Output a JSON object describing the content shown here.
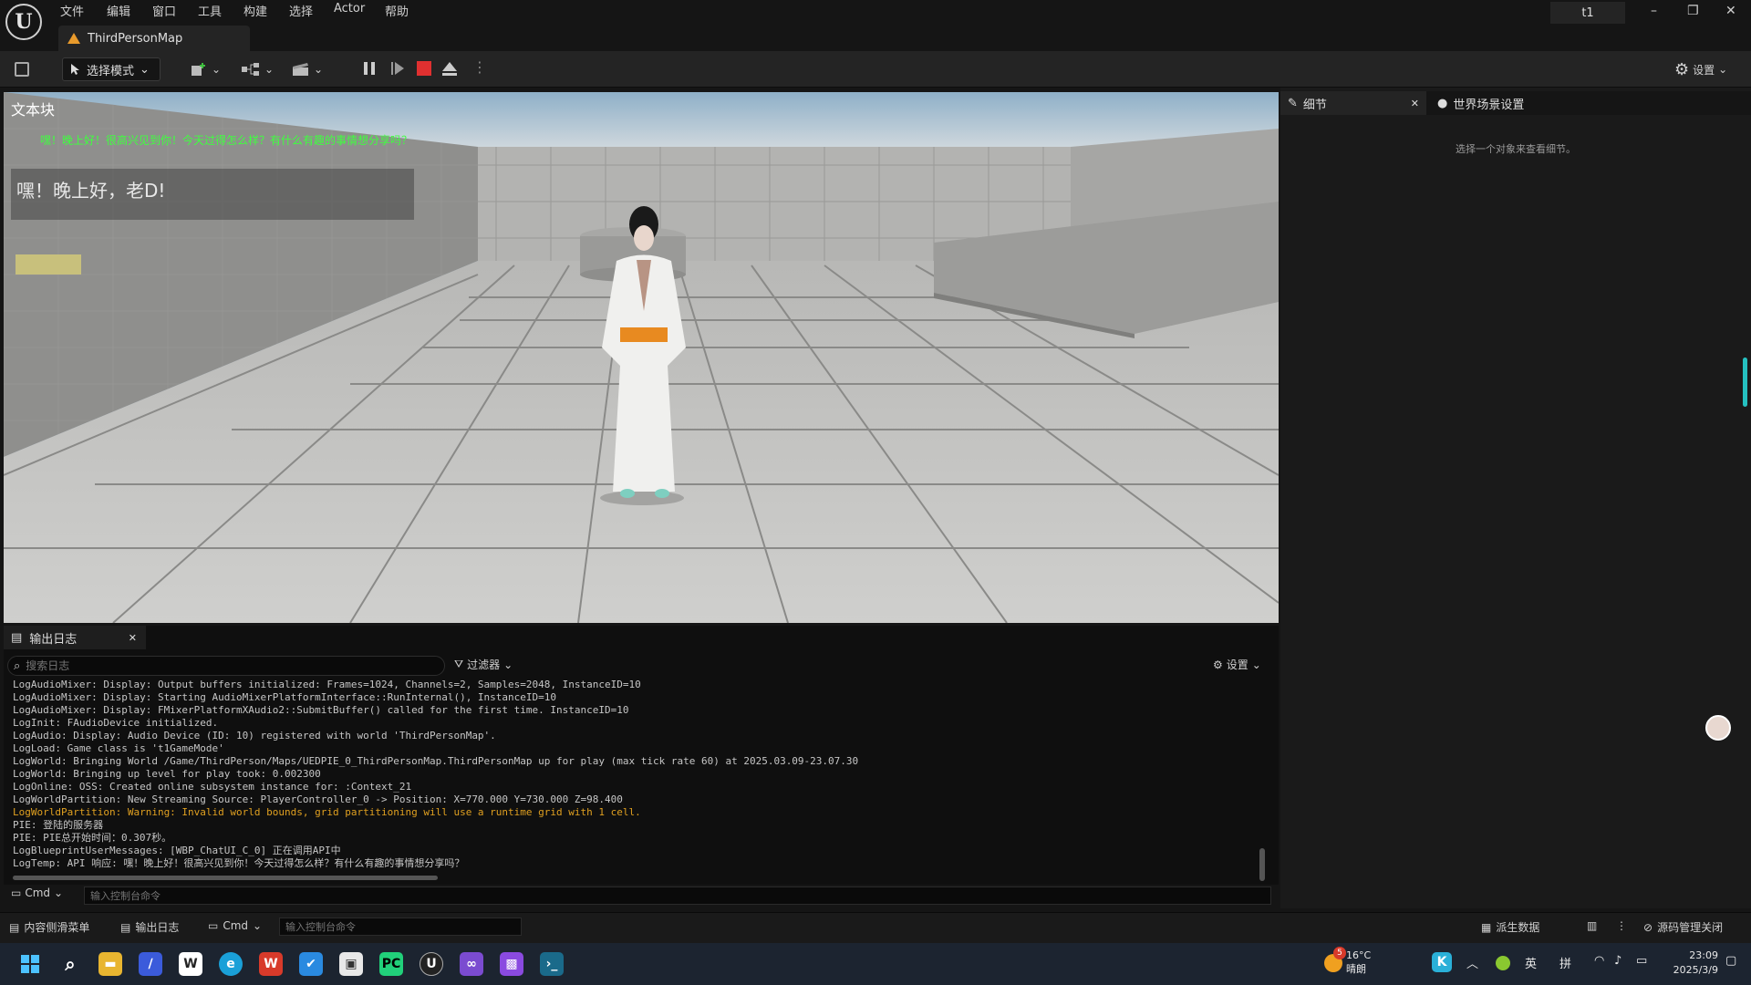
{
  "menu": [
    "文件",
    "编辑",
    "窗口",
    "工具",
    "构建",
    "选择",
    "Actor",
    "帮助"
  ],
  "window": {
    "user": "t1",
    "minimize": "–",
    "restore": "❐",
    "close": "✕"
  },
  "map_tab": "ThirdPersonMap",
  "toolbar": {
    "mode": "选择模式",
    "settings": "设置"
  },
  "viewport": {
    "title": "文本块",
    "green_text": "嘿！晚上好！很高兴见到你！今天过得怎么样？有什么有趣的事情想分享吗？",
    "chat_text": "嘿！晚上好，老D!"
  },
  "panels": {
    "details_tab": "细节",
    "world_tab": "世界场景设置",
    "hint": "选择一个对象来查看细节。"
  },
  "output_log": {
    "tab": "输出日志",
    "search_placeholder": "搜索日志",
    "filter": "过滤器",
    "settings": "设置",
    "lines": [
      {
        "text": "LogAudioMixer: Display: Output buffers initialized: Frames=1024, Channels=2, Samples=2048, InstanceID=10",
        "level": "info"
      },
      {
        "text": "LogAudioMixer: Display: Starting AudioMixerPlatformInterface::RunInternal(), InstanceID=10",
        "level": "info"
      },
      {
        "text": "LogAudioMixer: Display: FMixerPlatformXAudio2::SubmitBuffer() called for the first time. InstanceID=10",
        "level": "info"
      },
      {
        "text": "LogInit: FAudioDevice initialized.",
        "level": "info"
      },
      {
        "text": "LogAudio: Display: Audio Device (ID: 10) registered with world 'ThirdPersonMap'.",
        "level": "info"
      },
      {
        "text": "LogLoad: Game class is 't1GameMode'",
        "level": "info"
      },
      {
        "text": "LogWorld: Bringing World /Game/ThirdPerson/Maps/UEDPIE_0_ThirdPersonMap.ThirdPersonMap up for play (max tick rate 60) at 2025.03.09-23.07.30",
        "level": "info"
      },
      {
        "text": "LogWorld: Bringing up level for play took: 0.002300",
        "level": "info"
      },
      {
        "text": "LogOnline: OSS: Created online subsystem instance for: :Context_21",
        "level": "info"
      },
      {
        "text": "LogWorldPartition: New Streaming Source: PlayerController_0 -> Position: X=770.000 Y=730.000 Z=98.400",
        "level": "info"
      },
      {
        "text": "LogWorldPartition: Warning: Invalid world bounds, grid partitioning will use a runtime grid with 1 cell.",
        "level": "warn"
      },
      {
        "text": "PIE: 登陆的服务器",
        "level": "info"
      },
      {
        "text": "PIE: PIE总开始时间：0.307秒。",
        "level": "info"
      },
      {
        "text": "LogBlueprintUserMessages: [WBP_ChatUI_C_0] 正在调用API中",
        "level": "info"
      },
      {
        "text": "LogTemp: API 响应: 嘿！晚上好！很高兴见到你！今天过得怎么样？有什么有趣的事情想分享吗？",
        "level": "info"
      }
    ],
    "cmd_label": "Cmd",
    "cmd_placeholder": "输入控制台命令"
  },
  "statusbar": {
    "content_drawer": "内容侧滑菜单",
    "output_log": "输出日志",
    "cmd": "Cmd",
    "cmd_placeholder": "输入控制台命令",
    "derived_data": "派生数据",
    "source_control": "源码管理关闭"
  },
  "taskbar": {
    "weather_temp": "16°C",
    "weather_desc": "晴朗",
    "weather_badge": "5",
    "lang1": "英",
    "lang2": "拼",
    "time": "23:09",
    "date": "2025/3/9"
  },
  "colors": {
    "accent_orange": "#e89a2c",
    "warning": "#e0a020",
    "green_text": "#3fff3f",
    "stop_red": "#e03030"
  }
}
